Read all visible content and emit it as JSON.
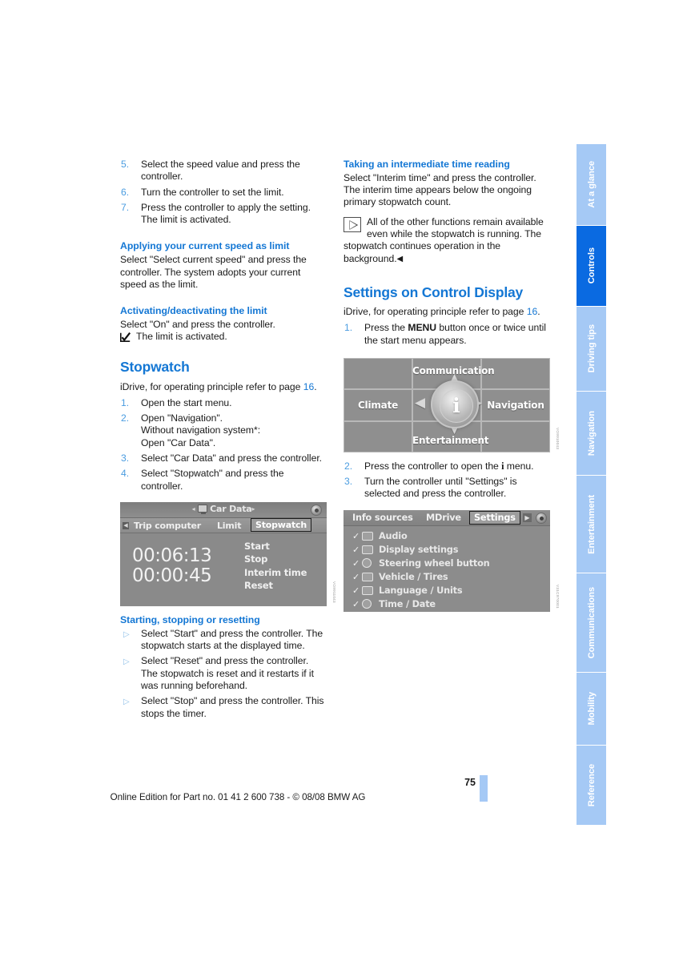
{
  "page": {
    "number": "75",
    "footer_text": "Online Edition for Part no. 01 41 2 600 738 - © 08/08 BMW AG"
  },
  "rail": {
    "tabs": [
      {
        "label": "At a glance",
        "active": false
      },
      {
        "label": "Controls",
        "active": true
      },
      {
        "label": "Driving tips",
        "active": false
      },
      {
        "label": "Navigation",
        "active": false
      },
      {
        "label": "Entertainment",
        "active": false
      },
      {
        "label": "Communications",
        "active": false
      },
      {
        "label": "Mobility",
        "active": false
      },
      {
        "label": "Reference",
        "active": false
      }
    ],
    "active_color": "#0a6ae1",
    "inactive_color": "#a5c9f5"
  },
  "left_column": {
    "steps_continued": [
      {
        "num": "5.",
        "text": "Select the speed value and press the controller."
      },
      {
        "num": "6.",
        "text": "Turn the controller to set the limit."
      },
      {
        "num": "7.",
        "text": "Press the controller to apply the setting. The limit is activated."
      }
    ],
    "section_current_speed": {
      "heading": "Applying your current speed as limit",
      "body": "Select \"Select current speed\" and press the controller. The system adopts your current speed as the limit."
    },
    "section_activating": {
      "heading": "Activating/deactivating the limit",
      "body": "Select \"On\" and press the controller.",
      "check_text": "The limit is activated."
    },
    "section_stopwatch": {
      "heading": "Stopwatch",
      "intro_prefix": "iDrive, for operating principle refer to page ",
      "intro_page": "16",
      "intro_suffix": ".",
      "steps": [
        {
          "num": "1.",
          "text": "Open the start menu."
        },
        {
          "num": "2.",
          "text": "Open \"Navigation\".\nWithout navigation system*:\nOpen \"Car Data\"."
        },
        {
          "num": "3.",
          "text": "Select \"Car Data\" and press the controller."
        },
        {
          "num": "4.",
          "text": "Select \"Stopwatch\" and press the controller."
        }
      ]
    },
    "figure_cardata": {
      "code": "VO9911043",
      "title": "Car Data",
      "tabs": [
        "Trip computer",
        "Limit",
        "Stopwatch"
      ],
      "selected_tab": "Stopwatch",
      "time_primary": "00:06:13",
      "time_interim": "00:00:45",
      "menu_items": [
        "Start",
        "Stop",
        "Interim time",
        "Reset"
      ]
    },
    "section_start_stop": {
      "heading": "Starting, stopping or resetting",
      "bullets": [
        "Select \"Start\" and press the controller. The stopwatch starts at the displayed time.",
        "Select \"Reset\" and press the controller. The stopwatch is reset and it restarts if it was running beforehand.",
        "Select \"Stop\" and press the controller. This stops the timer."
      ]
    }
  },
  "right_column": {
    "section_intermediate": {
      "heading": "Taking an intermediate time reading",
      "body": "Select \"Interim time\" and press the controller. The interim time appears below the ongoing primary stopwatch count.",
      "note": "All of the other functions remain available even while the stopwatch is running. The stopwatch continues operation in the background."
    },
    "section_settings": {
      "heading": "Settings on Control Display",
      "intro_prefix": "iDrive, for operating principle refer to page ",
      "intro_page": "16",
      "intro_suffix": ".",
      "step1_pre": "Press the ",
      "step1_bold": "MENU",
      "step1_post": " button once or twice until the start menu appears.",
      "step1_num": "1.",
      "step2_num": "2.",
      "step2_pre": "Press the controller to open the ",
      "step2_icon": "i",
      "step2_post": " menu.",
      "step3_num": "3.",
      "step3_text": "Turn the controller until \"Settings\" is selected and press the controller."
    },
    "figure_startmenu": {
      "code": "VO9910043",
      "cells": [
        "Communication",
        "Climate",
        "Navigation",
        "Entertainment"
      ],
      "hub_icon": "i"
    },
    "figure_settings": {
      "code": "V31C970001",
      "tabs": [
        "Info sources",
        "MDrive",
        "Settings"
      ],
      "selected_tab": "Settings",
      "rows": [
        {
          "label": "Audio",
          "icon": "speaker-icon"
        },
        {
          "label": "Display settings",
          "icon": "display-icon"
        },
        {
          "label": "Steering wheel button",
          "icon": "steering-wheel-icon"
        },
        {
          "label": "Vehicle / Tires",
          "icon": "car-icon"
        },
        {
          "label": "Language / Units",
          "icon": "flag-icon"
        },
        {
          "label": "Time / Date",
          "icon": "clock-icon"
        }
      ]
    }
  }
}
